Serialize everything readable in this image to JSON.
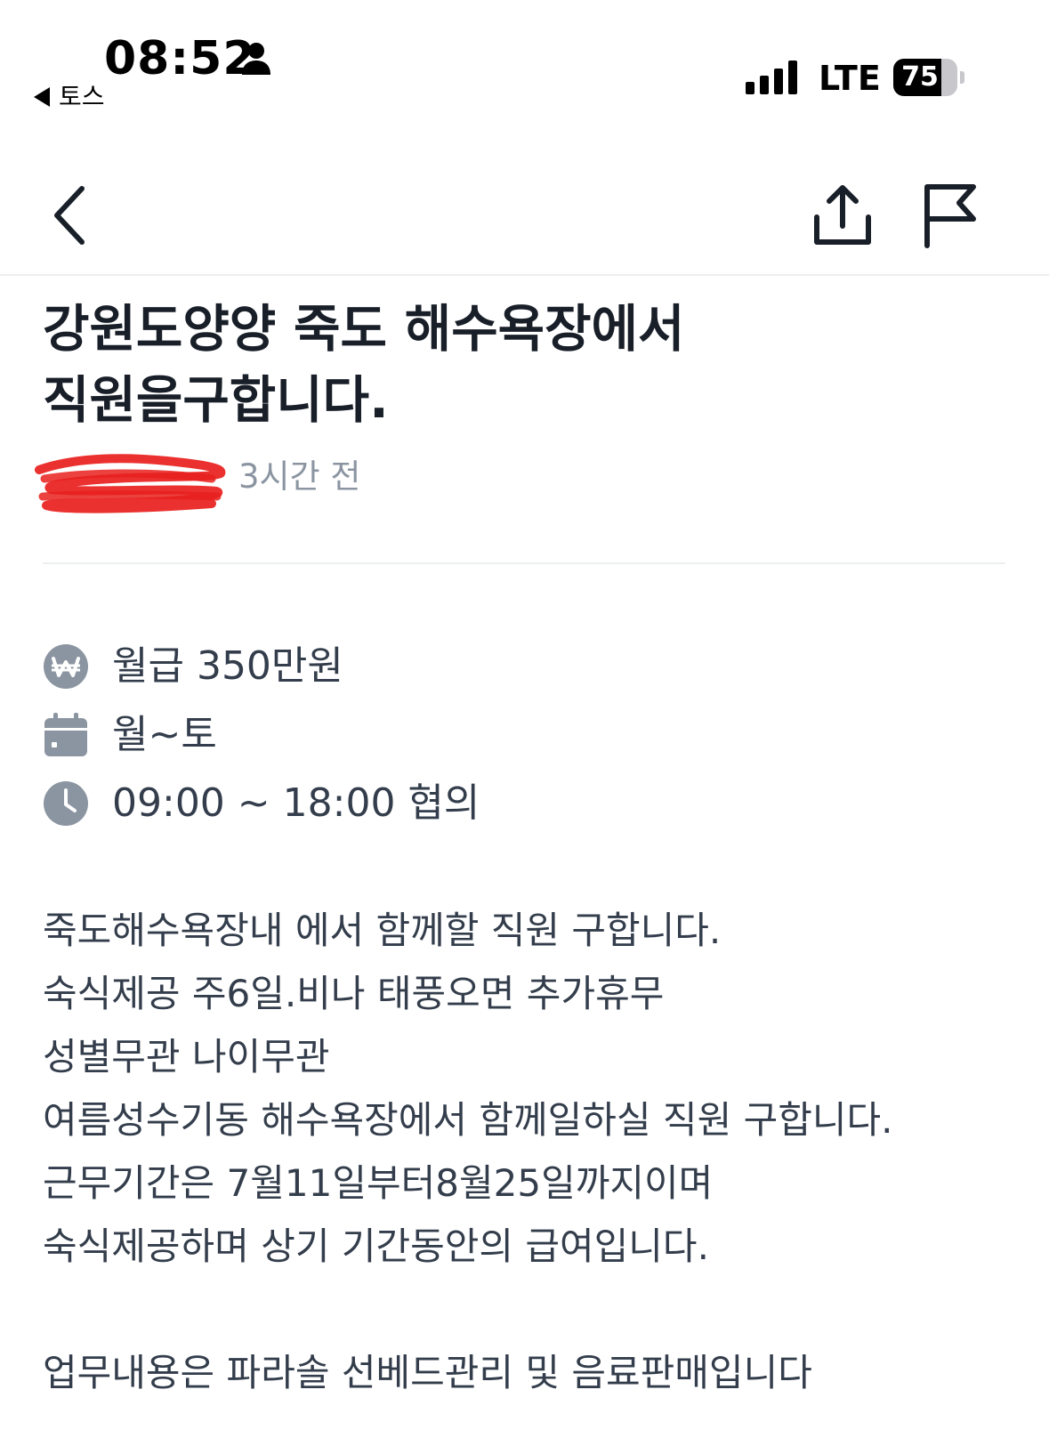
{
  "status_bar": {
    "time": "08:52",
    "back_app_label": "토스",
    "network": "LTE",
    "battery_level": "75",
    "battery_fraction": 0.75,
    "icons": [
      "person-icon",
      "signal-icon",
      "battery-icon"
    ]
  },
  "nav": {
    "icons": [
      "back-chevron-icon",
      "share-icon",
      "report-flag-icon"
    ]
  },
  "post": {
    "title": "강원도양양 죽도 해수욕장에서 직원을구합니다.",
    "time_ago": "3시간 전"
  },
  "info": {
    "salary": "월급 350만원",
    "days": "월~토",
    "hours": "09:00 ~ 18:00 협의",
    "icons": [
      "won-icon",
      "calendar-icon",
      "clock-icon"
    ],
    "icon_color": "#8b95a1"
  },
  "description": {
    "lines": [
      "죽도해수욕장내 에서 함께할 직원 구합니다.",
      "숙식제공 주6일.비나 태풍오면 추가휴무",
      "성별무관 나이무관",
      "여름성수기동 해수욕장에서 함께일하실 직원 구합니다.",
      "근무기간은 7월11일부터8월25일까지이며",
      "숙식제공하며 상기 기간동안의 급여입니다.",
      "",
      "업무내용은 파라솔 선베드관리 및 음료판매입니다"
    ]
  },
  "colors": {
    "title_text": "#191f28",
    "body_text": "#333d4b",
    "muted_text": "#8b95a1",
    "redaction": "#e8201d",
    "divider": "#eceef0"
  }
}
